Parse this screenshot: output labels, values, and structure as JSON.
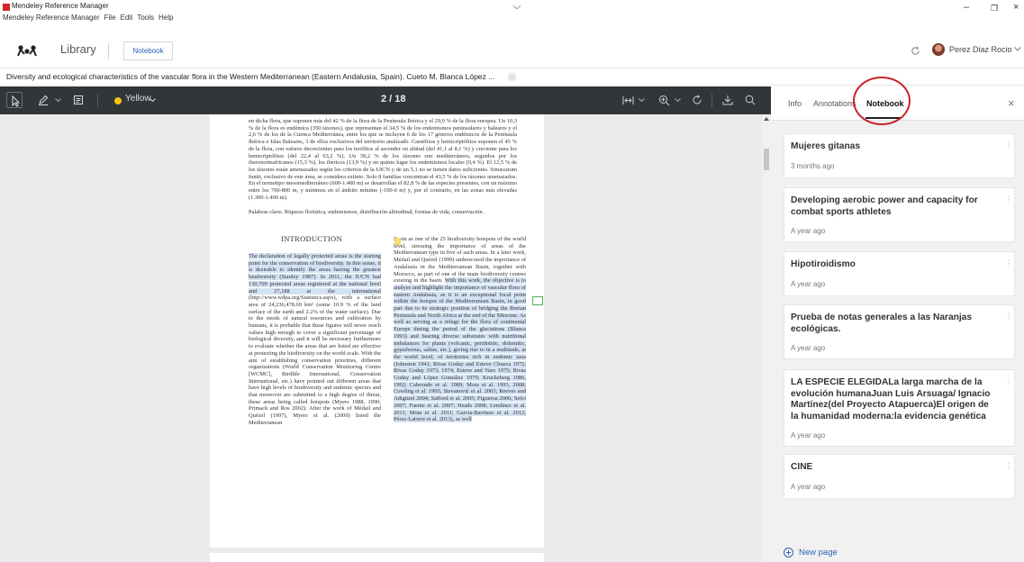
{
  "window": {
    "title": "Mendeley Reference Manager",
    "menu": [
      "Mendeley Reference Manager",
      "File",
      "Edit",
      "Tools",
      "Help"
    ],
    "controls": {
      "minimize": "–",
      "maximize": "❐",
      "close": "×"
    }
  },
  "toolbar": {
    "library_label": "Library",
    "notebook_tab": "Notebook",
    "user_name": "Perez Diaz Rocio"
  },
  "document": {
    "tab_title": "Diversity and ecological characteristics of the vascular flora in the Western Mediterranean (Eastern Andalusia, Spain). Cueto M, Blanca López ..."
  },
  "pdf_toolbar": {
    "highlight_color_name": "Yellow",
    "highlight_color": "#f4c20d",
    "page_indicator": "2 / 18"
  },
  "pdf_page": {
    "abstract": "en dicha flora, que suponen más del 42 % de la flora de la Península Ibérica y el 29,9 % de la flora europea. Un 10,3 % de la flora es endémica (350 táxones), que representan el 34,5 % de los endemismos peninsulares y baleares y el 2,6 % de los de la Cuenca Mediterránea, entre los que se incluyen 6 de los 17 géneros endémicos de la Península Ibérica e Islas Baleares, 3 de ellos exclusivos del territorio analizado. Caméfitos y hemicriptófitos suponen el 45 % de la flora, con valores decrecientes para los terófitos al ascender en altitud (del 41,1 al 8,1 %) y creciente para los hemicriptófitos (del 22,4 al 63,2 %). Un 39,2 % de los táxones son mediterráneos, seguidos por los iberonorteafricanos (15,3 %), los ibéricos (13,9 %) y en quinto lugar los endemismos locales (9,4 %). El 12,5 % de los táxones están amenazados según los criterios de la UICN y de un 5,1 no se tienen datos suficientes. Sinuraxtum funiti, exclusivo de este área, se considera extinto. Solo 8 familias concentran el 43,5 % de los táxones amenazados. En el termotipo mesomediterráneo (600-1.400 m) se desarrollan el 82,8 % de las especies presentes, con un máximo entre los 700-800 m, y mínimos en el ámbito mínimo (-100-0 m) y, por el contrario, en las zonas más elevadas (1.300-1.400 m).",
    "keywords": "Palabras clave. Riqueza florística, endemismos, distribución altitudinal, formas de vida, conservación.",
    "intro_heading": "INTRODUCTION",
    "col1_highlight": "The declaration of legally protected areas is the starting point for the conservation of biodiversity. In this sense, it is desirable to identify the areas having the greatest biodiversity (Stanley 1987). In 2011, the IUCN had 130,709 protected areas registered at the national level and 27,188 at the international",
    "col1_rest": "(http://www.wdpa.org/Statistics.aspx), with a surface area of 24,236,478.69 km² (some 10.9 % of the land surface of the earth and 2.2% of the water surface). Due to the needs of natural resources and cultivation by humans, it is probable that these figures will never reach values high enough to cover a significant percentage of biological diversity, and it will be necessary furthermore to evaluate whether the areas that are listed are effective at protecting the biodiversity on the world scale. With the aim of establishing conservation priorities, different organizations (World Conservation Monitoring Centre [WCMC], Birdlife International, Conservation International, etc.) have pointed out different areas that have high levels of biodiversity and endemic species and that moreover are submitted to a high degree of threat, these areas being called hotspots (Myers 1988, 1990; Primack and Ros 2002). After the work of Médail and Quézel (1997), Myers et al. (2000) listed the Mediterranean",
    "col2_top": "Basin as one of the 25 biodiversity hotspots of the world level, stressing the importance of areas of the Mediterranean type in five of such areas. In a later work, Médail and Quézel (1999) underscored the importance of Andalusia in the Mediterranean Basin, together with Morocco, as part of one of the main biodiversity centres existing in the basin.",
    "col2_highlight": "With this work, the objective is to analyse and highlight the importance of vascular flora of eastern Andalusia, as it is an exceptional focal point within the hotspot of the Mediterranean Basin, in good part due to its strategic position of bridging the Iberian Peninsula and North Africa at the end of the Miocene. As well as serving as a refuge for the flora of continental Europe during the period of the glaciations (Blanca 1993) and bearing diverse substrates with nutritional imbalances for plants (volcanic, peridotitic, dolomitic, gypsiferous, saline, etc.), giving rise to in a multitude, at the world level, of territories rich in endemic taxa (Johnston 1941; Rivas Goday and Esteve Chueca 1972; Rivas Goday 1973, 1974; Esteve and Varo 1975; Rivas Goday and López González 1979; Kruckeberg 1986, 1992; Cabezudo et al. 1989; Mota et al. 1993, 2008; Cowling et al. 1995; Stevanović et al. 2003; Reeves and Adigüzel 2004; Safford et al. 2005; Figueroa 2006; Selvi 2007; Fuente et al. 2007; Heads 2008; Lendínez et al. 2011; Mota et al. 2011; García-Barriuso et al. 2012; Pérez-Latorre et al. 2013), as well"
  },
  "sidebar": {
    "tabs": [
      "Info",
      "Annotations",
      "Notebook"
    ],
    "active_tab": "Notebook",
    "notes": [
      {
        "title": "Mujeres gitanas",
        "date": "3 months ago"
      },
      {
        "title": "Developing aerobic power and capacity for combat sports athletes",
        "date": "A year ago"
      },
      {
        "title": "Hipotiroidismo",
        "date": "A year ago"
      },
      {
        "title": "Prueba de notas generales a las Naranjas ecológicas.",
        "date": "A year ago"
      },
      {
        "title": "LA ESPECIE ELEGIDALa larga marcha de la evolución humanaJuan Luis Arsuaga/ Ignacio Martínez(del Proyecto Atapuerca)El origen de la humanidad moderna:la evidencia genética",
        "date": "A year ago"
      },
      {
        "title": "CINE",
        "date": "A year ago"
      }
    ],
    "new_page_label": "New page"
  },
  "colors": {
    "accent": "#2e63b3",
    "annotation_circle": "#c9242b",
    "pdf_toolbar_bg": "#323639",
    "highlight_bg": "#d4e3f4"
  }
}
